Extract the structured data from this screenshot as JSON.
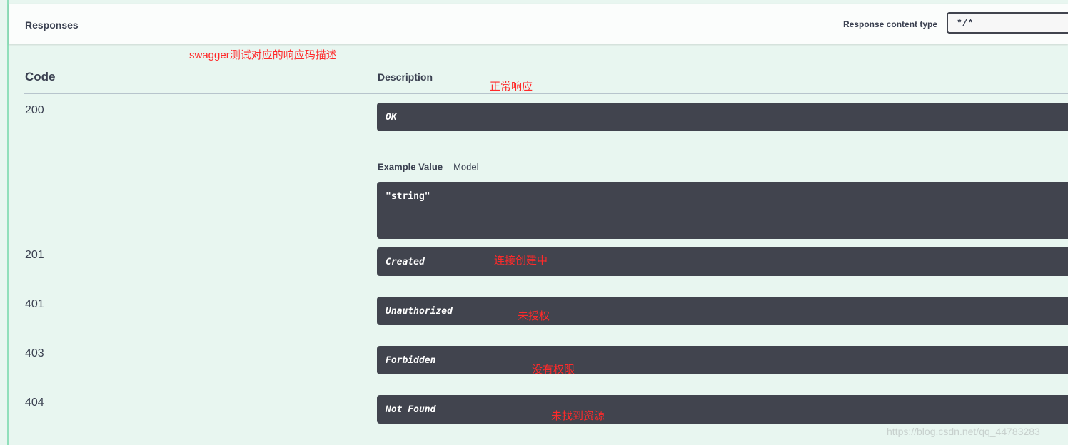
{
  "header": {
    "title": "Responses",
    "content_type_label": "Response content type",
    "content_type_value": "*/*"
  },
  "annotations": {
    "main": "swagger测试对应的响应码描述",
    "r200": "正常响应",
    "r201": "连接创建中",
    "r401": "未授权",
    "r403": "没有权限",
    "r404": "未找到资源"
  },
  "table": {
    "col_code": "Code",
    "col_description": "Description"
  },
  "responses": [
    {
      "code": "200",
      "description": "OK"
    },
    {
      "code": "201",
      "description": "Created"
    },
    {
      "code": "401",
      "description": "Unauthorized"
    },
    {
      "code": "403",
      "description": "Forbidden"
    },
    {
      "code": "404",
      "description": "Not Found"
    }
  ],
  "example": {
    "tab_example": "Example Value",
    "tab_model": "Model",
    "value": "\"string\""
  },
  "watermark": "https://blog.csdn.net/qq_44783283",
  "colors": {
    "background": "#e8f6f0",
    "accent": "#49cc90",
    "dark_box": "#41444e",
    "annotation": "#ff2a2a"
  }
}
